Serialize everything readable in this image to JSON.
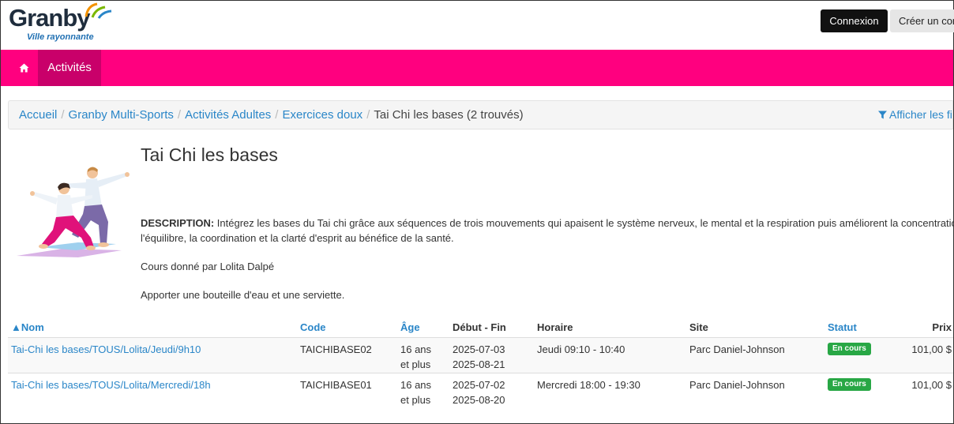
{
  "header": {
    "logo_text": "Granby",
    "logo_tagline": "Ville rayonnante",
    "login_label": "Connexion",
    "create_label": "Créer un compte"
  },
  "nav": {
    "home_icon": "home-icon",
    "activities_label": "Activités",
    "color": "#ff007f",
    "active_color": "#c9006a"
  },
  "breadcrumb": {
    "items": [
      "Accueil",
      "Granby Multi-Sports",
      "Activités Adultes",
      "Exercices doux"
    ],
    "current": "Tai Chi les bases (2 trouvés)",
    "filters_label": "Afficher les filtres"
  },
  "activity": {
    "title": "Tai Chi les bases",
    "description_label": "DESCRIPTION:",
    "description_text": " Intégrez les bases du Tai chi grâce aux séquences de trois mouvements qui apaisent le système nerveux, le mental et la respiration puis améliorent la concentration,",
    "description_line2": "l'équilibre, la coordination et la clarté d'esprit au bénéfice de la santé.",
    "instructor": "Cours donné par Lolita Dalpé",
    "note": "Apporter une bouteille d'eau et une serviette."
  },
  "table": {
    "headers": {
      "nom": "▲Nom",
      "code": "Code",
      "age": "Âge",
      "dates": "Début - Fin",
      "horaire": "Horaire",
      "site": "Site",
      "statut": "Statut",
      "prix": "Prix"
    },
    "rows": [
      {
        "nom": "Tai-Chi les bases/TOUS/Lolita/Jeudi/9h10",
        "code": "TAICHIBASE02",
        "age1": "16 ans",
        "age2": "et plus",
        "debut": "2025-07-03",
        "fin": "2025-08-21",
        "horaire": "Jeudi 09:10 - 10:40",
        "site": "Parc Daniel-Johnson",
        "statut": "En cours",
        "prix": "101,00 $"
      },
      {
        "nom": "Tai-Chi les bases/TOUS/Lolita/Mercredi/18h",
        "code": "TAICHIBASE01",
        "age1": "16 ans",
        "age2": "et plus",
        "debut": "2025-07-02",
        "fin": "2025-08-20",
        "horaire": "Mercredi 18:00 - 19:30",
        "site": "Parc Daniel-Johnson",
        "statut": "En cours",
        "prix": "101,00 $"
      }
    ]
  }
}
